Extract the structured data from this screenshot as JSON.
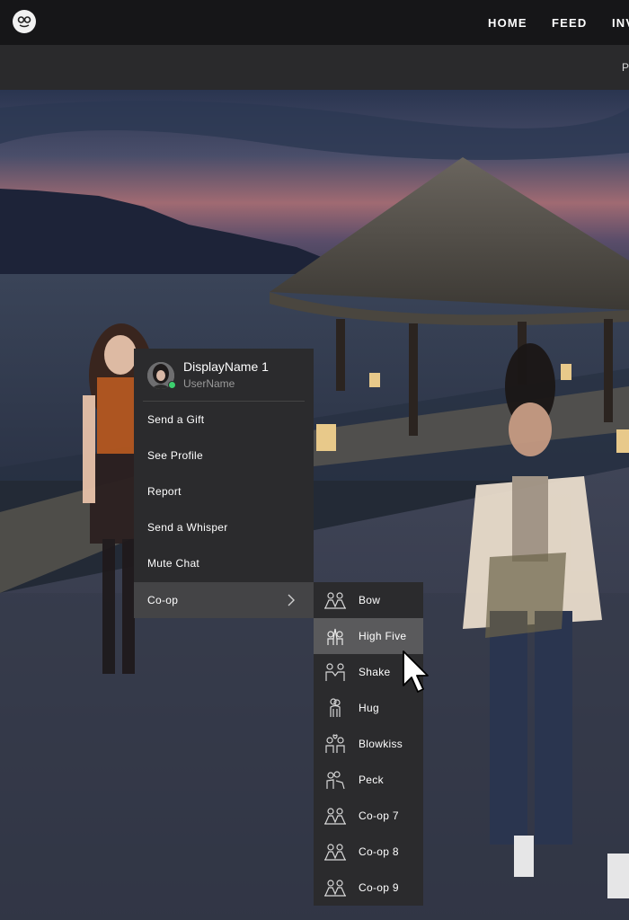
{
  "nav": {
    "home": "HOME",
    "feed": "FEED",
    "inv": "INV"
  },
  "subbar": {
    "partial_text": "P"
  },
  "context_menu": {
    "display_name": "DisplayName 1",
    "user_name": "UserName",
    "items": [
      "Send a Gift",
      "See Profile",
      "Report",
      "Send a Whisper",
      "Mute Chat",
      "Co-op"
    ]
  },
  "coop_submenu": {
    "items": [
      "Bow",
      "High Five",
      "Shake",
      "Hug",
      "Blowkiss",
      "Peck",
      "Co-op 7",
      "Co-op 8",
      "Co-op 9"
    ],
    "highlighted": "High Five"
  },
  "colors": {
    "online_status": "#3ccf6e",
    "menu_bg": "#2b2b2d",
    "highlight": "#5a5a5c"
  }
}
